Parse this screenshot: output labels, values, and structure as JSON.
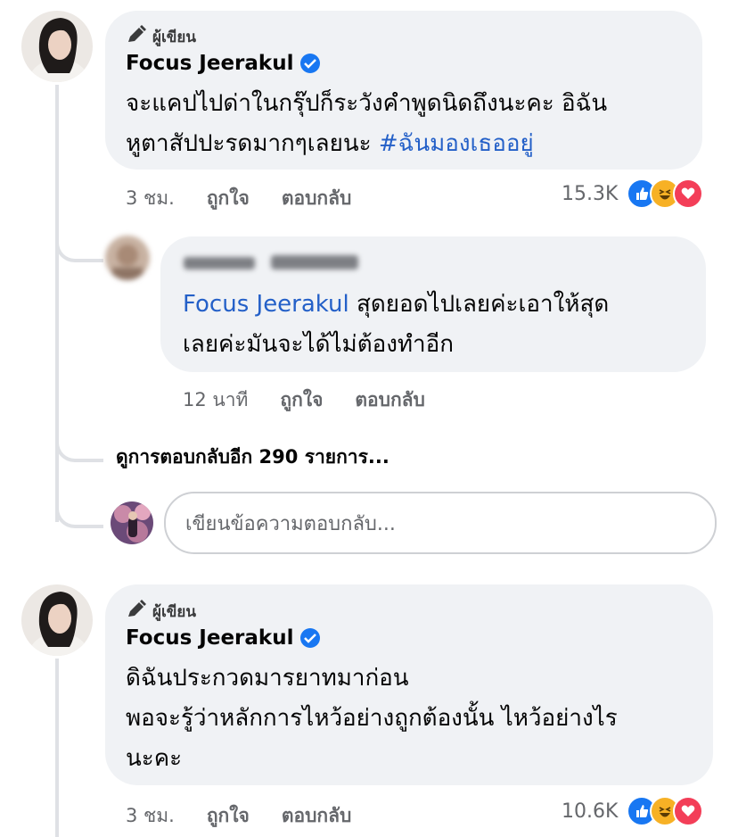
{
  "comments": [
    {
      "author_badge": "ผู้เขียน",
      "author_name": "Focus Jeerakul",
      "text_line1": "จะแคปไปด่าในกรุ๊ปก็ระวังคำพูดนิดถึงนะคะ อิฉัน",
      "text_line2_plain": "หูตาสัปปะรดมากๆเลยนะ ",
      "hashtag": "#ฉันมองเธออยู่",
      "time": "3 ชม.",
      "like_label": "ถูกใจ",
      "reply_label": "ตอบกลับ",
      "reaction_count": "15.3K"
    },
    {
      "author_badge": "ผู้เขียน",
      "author_name": "Focus Jeerakul",
      "text_line1": "ดิฉันประกวดมารยาทมาก่อน",
      "text_line2": "พอจะรู้ว่าหลักการไหว้อย่างถูกต้องนั้น ไหว้อย่างไร",
      "text_line3": "นะคะ",
      "time": "3 ชม.",
      "like_label": "ถูกใจ",
      "reply_label": "ตอบกลับ",
      "reaction_count": "10.6K"
    }
  ],
  "reply": {
    "mention": "Focus Jeerakul",
    "text_line1_rest": " สุดยอดไปเลยค่ะเอาให้สุด",
    "text_line2": "เลยค่ะมันจะได้ไม่ต้องทำอีก",
    "time": "12 นาที",
    "like_label": "ถูกใจ",
    "reply_label": "ตอบกลับ"
  },
  "more_replies": "ดูการตอบกลับอีก 290 รายการ...",
  "reply_input": {
    "placeholder": "เขียนข้อความตอบกลับ..."
  },
  "colors": {
    "link_blue": "#2460c8",
    "bubble_bg": "#f0f2f5",
    "like_blue": "#1877f2",
    "haha_yellow": "#f7b125",
    "love_red": "#f33e58"
  },
  "icons": [
    "pen-badge-icon",
    "verified-icon",
    "like-reaction-icon",
    "haha-reaction-icon",
    "love-reaction-icon"
  ]
}
